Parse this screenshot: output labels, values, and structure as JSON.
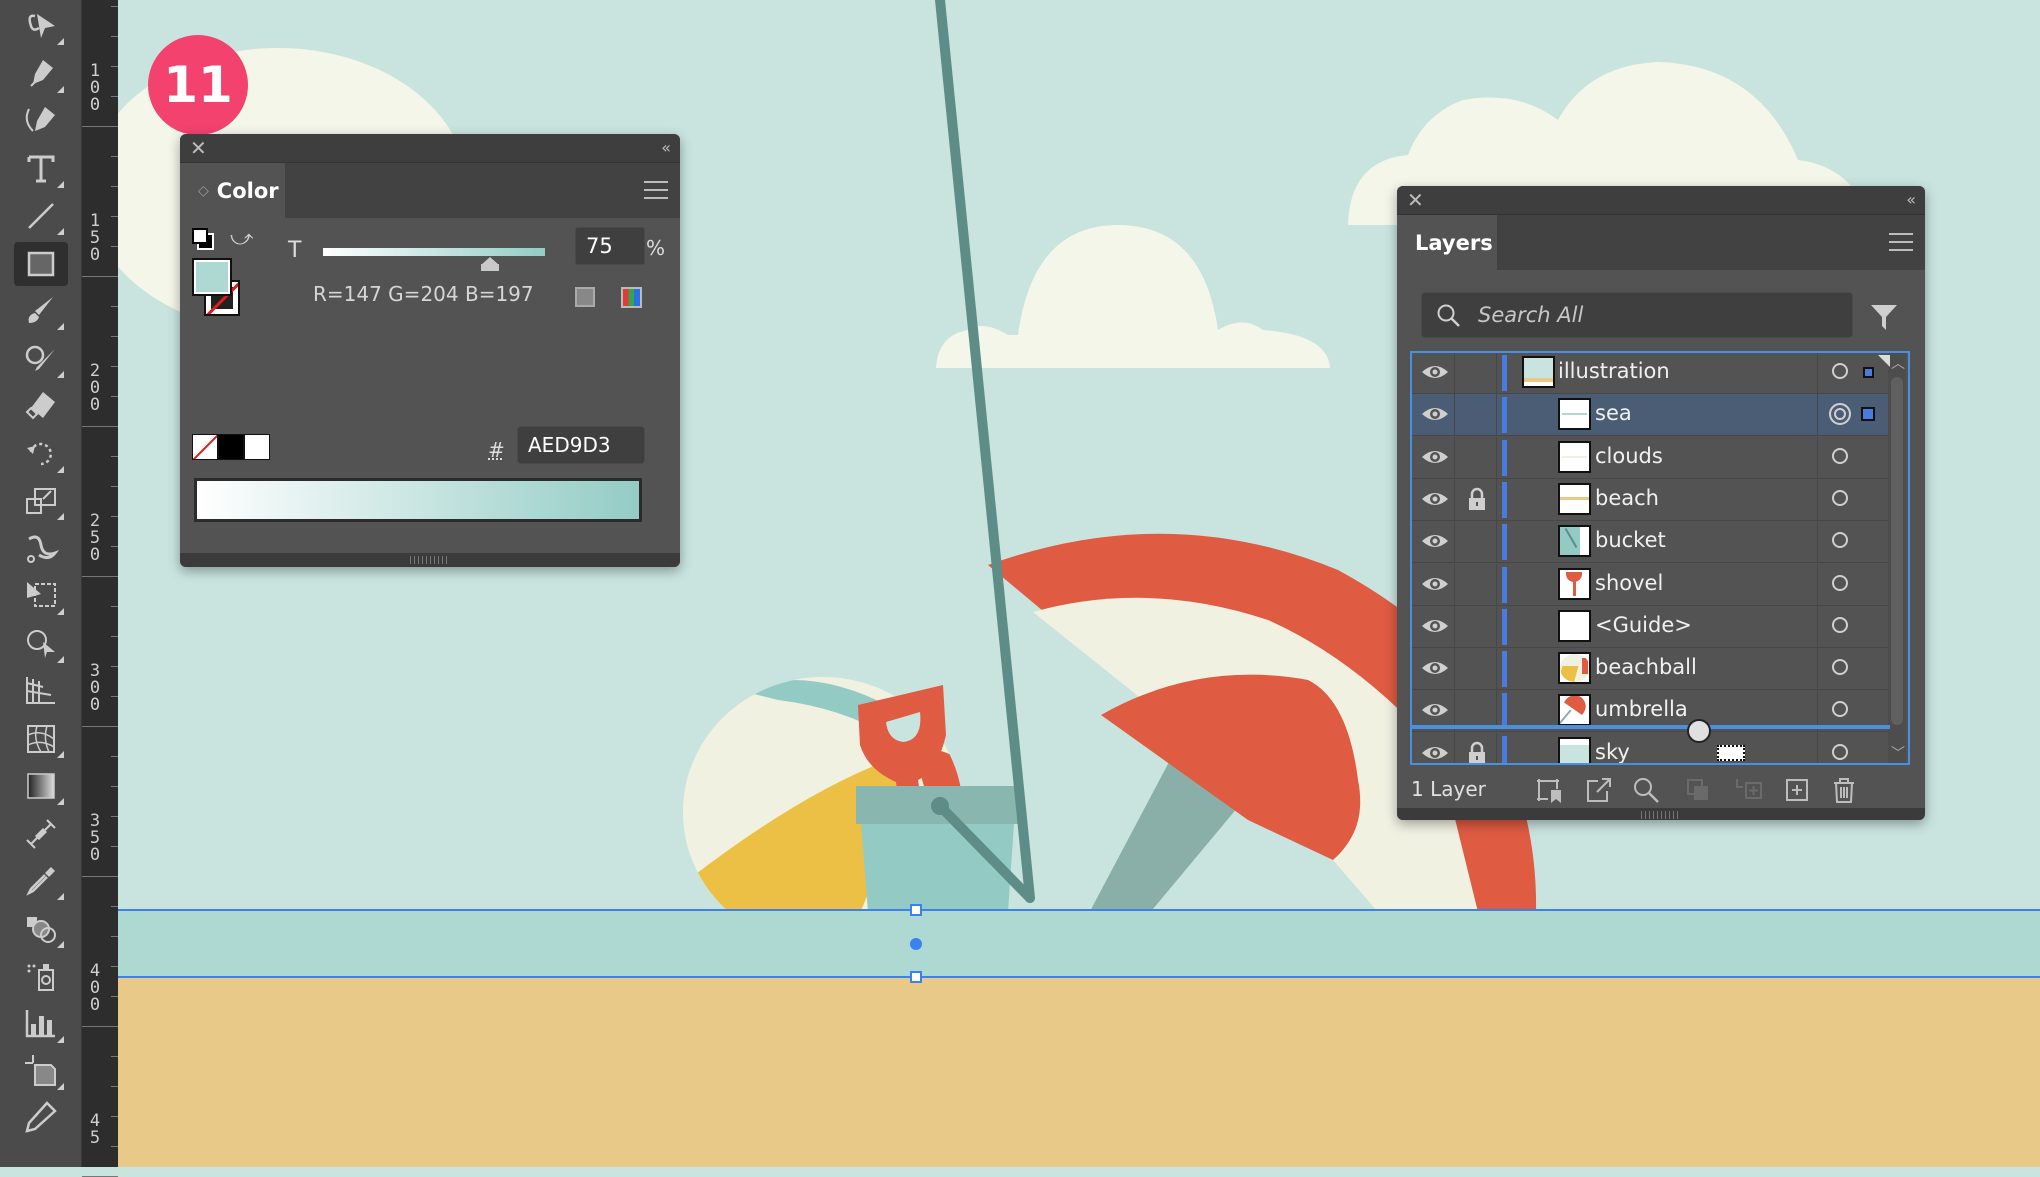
{
  "step_badge": "11",
  "toolbar": {
    "tools": [
      {
        "name": "selection-tool",
        "icon": "lasso-arrow-icon"
      },
      {
        "name": "pen-tool",
        "icon": "pen-icon"
      },
      {
        "name": "curvature-tool",
        "icon": "curvature-pen-icon"
      },
      {
        "name": "type-tool",
        "icon": "type-icon"
      },
      {
        "name": "line-tool",
        "icon": "line-icon"
      },
      {
        "name": "rectangle-tool",
        "icon": "rectangle-icon",
        "active": true
      },
      {
        "name": "paintbrush-tool",
        "icon": "brush-icon"
      },
      {
        "name": "shaper-tool",
        "icon": "shaper-icon"
      },
      {
        "name": "eraser-tool",
        "icon": "eraser-icon"
      },
      {
        "name": "rotate-tool",
        "icon": "rotate-icon"
      },
      {
        "name": "scale-tool",
        "icon": "scale-icon"
      },
      {
        "name": "puppet-warp-tool",
        "icon": "warp-icon"
      },
      {
        "name": "free-transform-tool",
        "icon": "free-transform-icon"
      },
      {
        "name": "shape-builder-tool",
        "icon": "shape-builder-icon"
      },
      {
        "name": "perspective-grid-tool",
        "icon": "perspective-grid-icon"
      },
      {
        "name": "mesh-tool",
        "icon": "mesh-icon"
      },
      {
        "name": "gradient-tool",
        "icon": "gradient-icon"
      },
      {
        "name": "width-tool",
        "icon": "width-icon"
      },
      {
        "name": "eyedropper-tool",
        "icon": "eyedropper-icon"
      },
      {
        "name": "blend-tool",
        "icon": "blend-icon"
      },
      {
        "name": "symbol-sprayer-tool",
        "icon": "symbol-sprayer-icon"
      },
      {
        "name": "graph-tool",
        "icon": "graph-icon"
      },
      {
        "name": "artboard-tool",
        "icon": "artboard-icon"
      },
      {
        "name": "slice-tool",
        "icon": "slice-icon"
      }
    ]
  },
  "ruler": {
    "labels": [
      "100",
      "150",
      "200",
      "250",
      "300",
      "350",
      "400",
      "45"
    ]
  },
  "color_panel": {
    "tab_label": "Color",
    "tint_label": "T",
    "tint_value": "75",
    "tint_unit": "%",
    "rgb_readout": "R=147 G=204 B=197",
    "hex_prefix": "#",
    "hex_value": "AED9D3",
    "fill_color": "#AED9D3",
    "tint_fraction": 0.75
  },
  "layers_panel": {
    "tab_label": "Layers",
    "search_placeholder": "Search All",
    "footer_count": "1 Layer",
    "rows": [
      {
        "name": "illustration",
        "level": 0,
        "expanded": true,
        "locked": false,
        "visible": true,
        "has_children": true,
        "selected": false,
        "thumb": "illustration"
      },
      {
        "name": "sea",
        "level": 1,
        "expanded": false,
        "locked": false,
        "visible": true,
        "has_children": false,
        "selected": true,
        "thumb": "sea"
      },
      {
        "name": "clouds",
        "level": 1,
        "expanded": false,
        "locked": false,
        "visible": true,
        "has_children": true,
        "selected": false,
        "thumb": "clouds"
      },
      {
        "name": "beach",
        "level": 1,
        "expanded": false,
        "locked": true,
        "visible": true,
        "has_children": false,
        "selected": false,
        "thumb": "beach"
      },
      {
        "name": "bucket",
        "level": 1,
        "expanded": false,
        "locked": false,
        "visible": true,
        "has_children": true,
        "selected": false,
        "thumb": "bucket"
      },
      {
        "name": "shovel",
        "level": 1,
        "expanded": false,
        "locked": false,
        "visible": true,
        "has_children": true,
        "selected": false,
        "thumb": "shovel"
      },
      {
        "name": "<Guide>",
        "level": 1,
        "expanded": false,
        "locked": false,
        "visible": true,
        "has_children": false,
        "selected": false,
        "thumb": "guide"
      },
      {
        "name": "beachball",
        "level": 1,
        "expanded": false,
        "locked": false,
        "visible": true,
        "has_children": true,
        "selected": false,
        "thumb": "beachball"
      },
      {
        "name": "umbrella",
        "level": 1,
        "expanded": false,
        "locked": false,
        "visible": true,
        "has_children": true,
        "selected": false,
        "thumb": "umbrella"
      },
      {
        "name": "sky",
        "level": 1,
        "expanded": false,
        "locked": true,
        "visible": true,
        "has_children": false,
        "selected": false,
        "thumb": "sky"
      }
    ],
    "footer_buttons": [
      "collect-for-export-button",
      "export-button",
      "locate-object-button",
      "make-clipping-mask-button",
      "create-sublayer-button",
      "create-new-layer-button",
      "delete-layer-button"
    ]
  },
  "artwork_colors": {
    "sky": "#C9E4DF",
    "cloud": "#F4F6EA",
    "sea": "#AED9D3",
    "sand": "#E8C988",
    "red": "#DF5B41",
    "cream": "#F1F1E2",
    "yellow": "#ECC044",
    "teal": "#93CBC4",
    "teal_dark": "#8AB6B0",
    "handle": "#5E8D88",
    "pole": "#8AAEA8",
    "selection_blue": "#3C82EE"
  }
}
